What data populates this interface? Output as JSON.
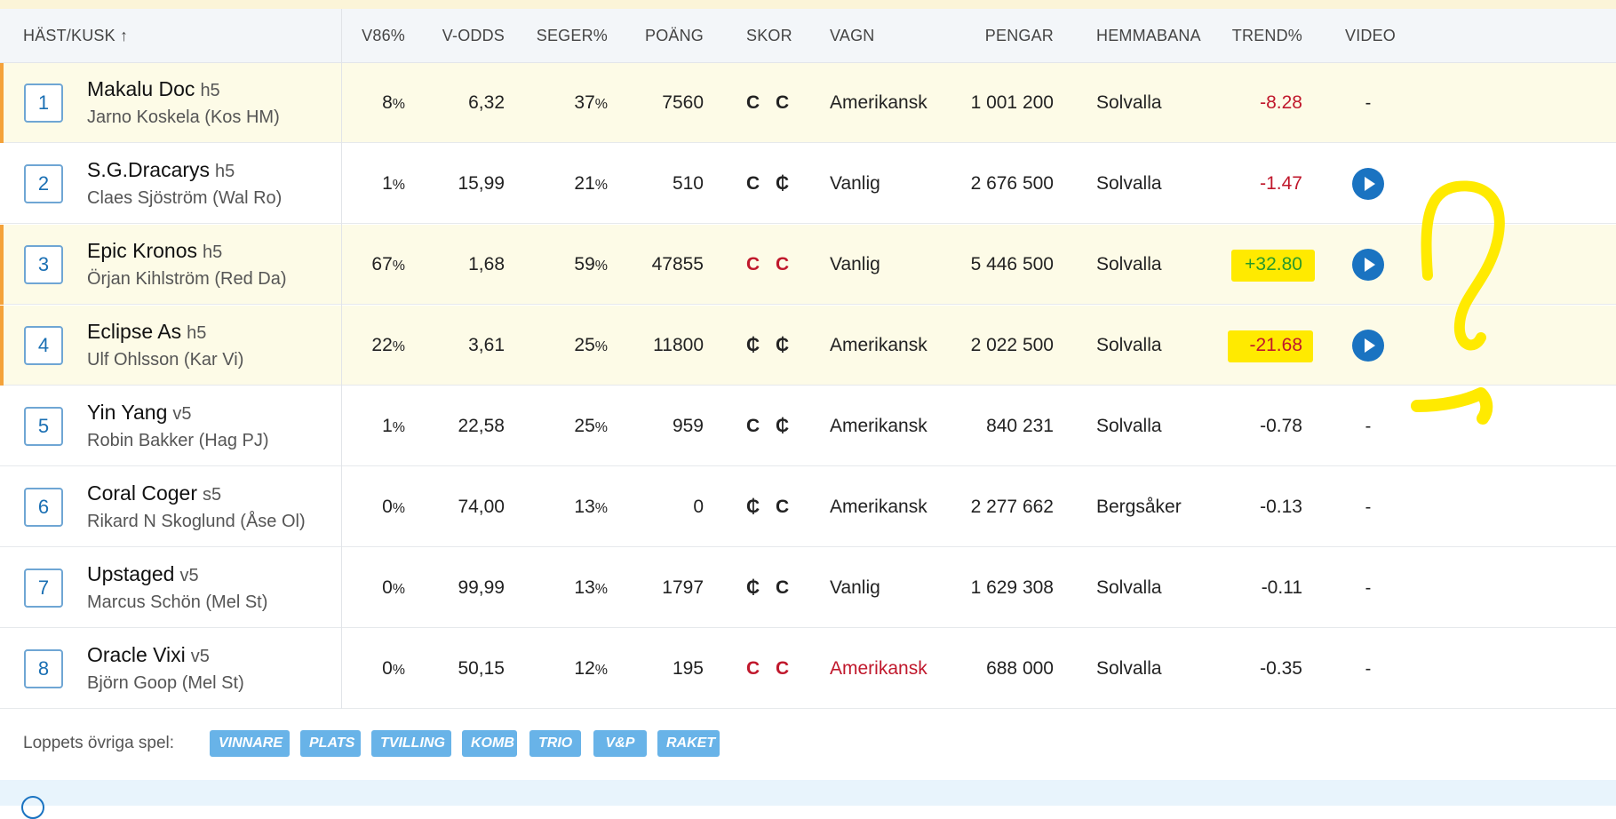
{
  "columns": {
    "horse": "HÄST/KUSK ↑",
    "v86": "V86%",
    "vodds": "V-ODDS",
    "win": "SEGER%",
    "points": "POÄNG",
    "shoes": "SKOR",
    "cart": "VAGN",
    "money": "PENGAR",
    "home": "HEMMABANA",
    "trend": "TREND%",
    "video": "VIDEO"
  },
  "rows": [
    {
      "num": "1",
      "name": "Makalu Doc",
      "age": "h5",
      "driver": "Jarno Koskela (Kos HM)",
      "v86": "8",
      "pct": "%",
      "vodds": "6,32",
      "win": "37",
      "points": "7560",
      "shoes": "C C",
      "cart": "Amerikansk",
      "money": "1 001 200",
      "home": "Solvalla",
      "trend": "-8.28",
      "video": "-"
    },
    {
      "num": "2",
      "name": "S.G.Dracarys",
      "age": "h5",
      "driver": "Claes Sjöström (Wal Ro)",
      "v86": "1",
      "pct": "%",
      "vodds": "15,99",
      "win": "21",
      "points": "510",
      "shoes": "C ₵",
      "cart": "Vanlig",
      "money": "2 676 500",
      "home": "Solvalla",
      "trend": "-1.47",
      "video": "play"
    },
    {
      "num": "3",
      "name": "Epic Kronos",
      "age": "h5",
      "driver": "Örjan Kihlström (Red Da)",
      "v86": "67",
      "pct": "%",
      "vodds": "1,68",
      "win": "59",
      "points": "47855",
      "shoes": "C C",
      "cart": "Vanlig",
      "money": "5 446 500",
      "home": "Solvalla",
      "trend": "+32.80",
      "video": "play"
    },
    {
      "num": "4",
      "name": "Eclipse As",
      "age": "h5",
      "driver": "Ulf Ohlsson (Kar Vi)",
      "v86": "22",
      "pct": "%",
      "vodds": "3,61",
      "win": "25",
      "points": "11800",
      "shoes": "₵ ₵",
      "cart": "Amerikansk",
      "money": "2 022 500",
      "home": "Solvalla",
      "trend": "-21.68",
      "video": "play"
    },
    {
      "num": "5",
      "name": "Yin Yang",
      "age": "v5",
      "driver": "Robin Bakker (Hag PJ)",
      "v86": "1",
      "pct": "%",
      "vodds": "22,58",
      "win": "25",
      "points": "959",
      "shoes": "C ₵",
      "cart": "Amerikansk",
      "money": "840 231",
      "home": "Solvalla",
      "trend": "-0.78",
      "video": "-"
    },
    {
      "num": "6",
      "name": "Coral Coger",
      "age": "s5",
      "driver": "Rikard N Skoglund (Åse Ol)",
      "v86": "0",
      "pct": "%",
      "vodds": "74,00",
      "win": "13",
      "points": "0",
      "shoes": "₵ C",
      "cart": "Amerikansk",
      "money": "2 277 662",
      "home": "Bergsåker",
      "trend": "-0.13",
      "video": "-"
    },
    {
      "num": "7",
      "name": "Upstaged",
      "age": "v5",
      "driver": "Marcus Schön (Mel St)",
      "v86": "0",
      "pct": "%",
      "vodds": "99,99",
      "win": "13",
      "points": "1797",
      "shoes": "₵ C",
      "cart": "Vanlig",
      "money": "1 629 308",
      "home": "Solvalla",
      "trend": "-0.11",
      "video": "-"
    },
    {
      "num": "8",
      "name": "Oracle Vixi",
      "age": "v5",
      "driver": "Björn Goop (Mel St)",
      "v86": "0",
      "pct": "%",
      "vodds": "50,15",
      "win": "12",
      "points": "195",
      "shoes": "C C",
      "cart": "Amerikansk",
      "money": "688 000",
      "home": "Solvalla",
      "trend": "-0.35",
      "video": "-"
    }
  ],
  "footer": {
    "label": "Loppets övriga spel:",
    "buttons": [
      "VINNARE",
      "PLATS",
      "TVILLING",
      "KOMB",
      "TRIO",
      "V&P",
      "RAKET"
    ]
  },
  "colors": {
    "highlight_row": "#fdfbe7",
    "accent_bar": "#f4a23a",
    "negative": "#c0182c",
    "positive": "#2b9a2a",
    "play": "#1a73c1",
    "marker": "#ffea00"
  }
}
